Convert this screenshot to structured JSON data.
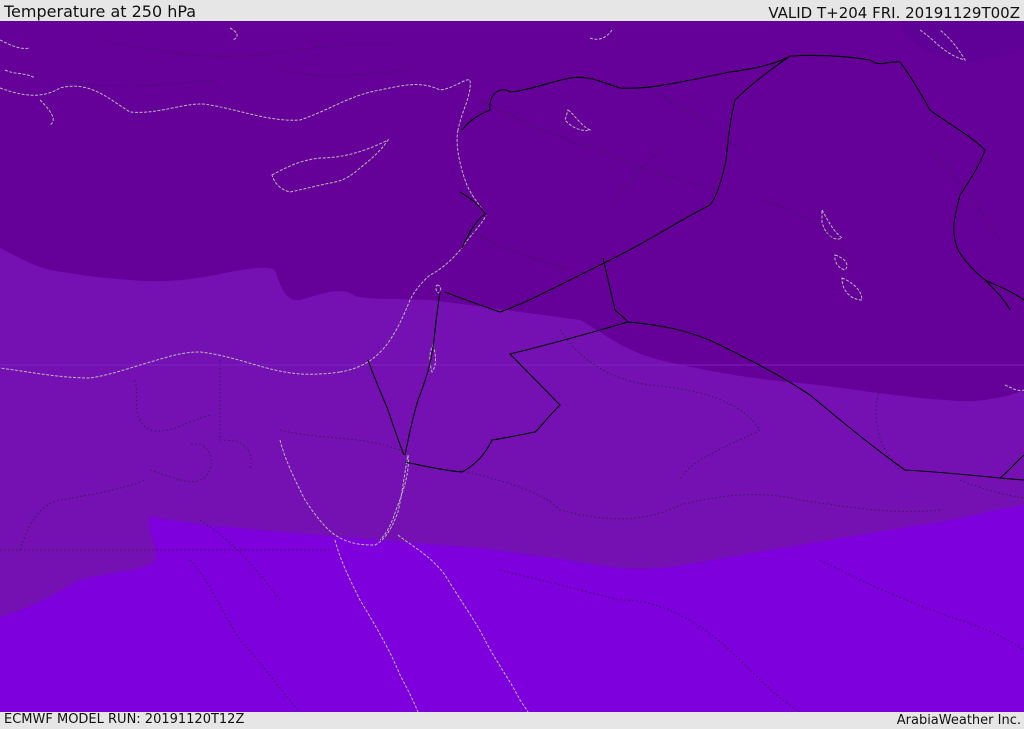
{
  "header": {
    "title": "Temperature at 250 hPa",
    "valid": "VALID T+204 FRI. 20191129T00Z"
  },
  "footer": {
    "model_run": "ECMWF MODEL RUN: 20191120T12Z",
    "credit": "ArabiaWeather Inc."
  },
  "map": {
    "field": "temperature-250hPa",
    "colors": {
      "coldest_band": "#5f0096",
      "cold_band": "#650098",
      "middle_band": "#7511b3",
      "warm_band": "#7d00dd",
      "coastline": "#b8b8b8",
      "border": "#000000"
    }
  }
}
